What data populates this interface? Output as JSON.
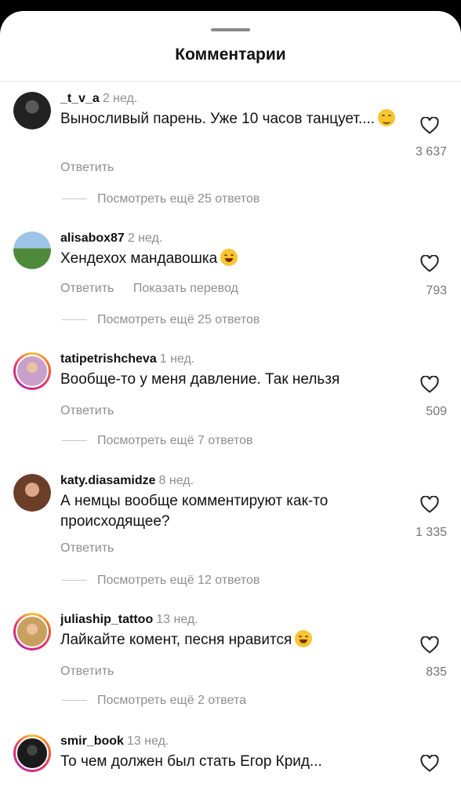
{
  "title": "Комментарии",
  "comments": [
    {
      "username": "_t_v_a",
      "time": "2 нед.",
      "text": "Выносливый парень. Уже 10 часов танцует....",
      "emoji": "smiling-face-icon",
      "actions": [
        "Ответить"
      ],
      "likes": "3 637",
      "more": "Посмотреть ещё 25 ответов"
    },
    {
      "username": "alisabox87",
      "time": "2 нед.",
      "text": "Хендехох мандавошка",
      "emoji": "tears-of-joy-icon",
      "actions": [
        "Ответить",
        "Показать перевод"
      ],
      "likes": "793",
      "more": "Посмотреть ещё 25 ответов"
    },
    {
      "username": "tatipetrishcheva",
      "time": "1 нед.",
      "text": "Вообще-то у меня давление. Так нельзя",
      "actions": [
        "Ответить"
      ],
      "likes": "509",
      "more": "Посмотреть ещё 7 ответов"
    },
    {
      "username": "katy.diasamidze",
      "time": "8 нед.",
      "text": "А немцы вообще комментируют как-то происходящее?",
      "actions": [
        "Ответить"
      ],
      "likes": "1 335",
      "more": "Посмотреть ещё 12 ответов"
    },
    {
      "username": "juliaship_tattoo",
      "time": "13 нед.",
      "text": "Лайкайте комент, песня нравится",
      "emoji": "tears-of-joy-icon",
      "actions": [
        "Ответить"
      ],
      "likes": "835",
      "more": "Посмотреть ещё 2 ответа"
    },
    {
      "username": "smir_book",
      "time": "13 нед.",
      "text": "То чем должен был стать Егор Крид..."
    }
  ]
}
